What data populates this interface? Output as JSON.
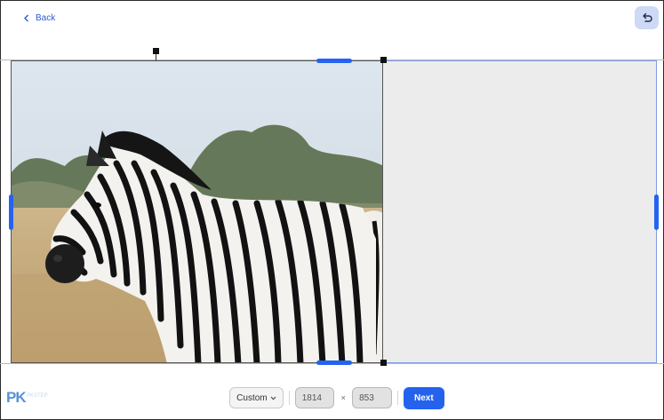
{
  "header": {
    "back_label": "Back",
    "back_icon": "chevron-left-icon",
    "undo_icon": "undo-icon"
  },
  "image": {
    "subject": "zebra in a grassy field",
    "sky_color": "#dbe4ec",
    "grass_color": "#c7ac7c"
  },
  "toolbar": {
    "ratio_label": "Custom",
    "ratio_icon": "chevron-down-icon",
    "width_value": "1814",
    "separator": "×",
    "height_value": "853",
    "next_label": "Next"
  },
  "watermark": {
    "logo_text": "PK",
    "logo_subtext": "PKSTEP"
  },
  "colors": {
    "accent": "#2463ef",
    "canvas_fill": "#ececec",
    "canvas_border": "#7d9be7"
  }
}
